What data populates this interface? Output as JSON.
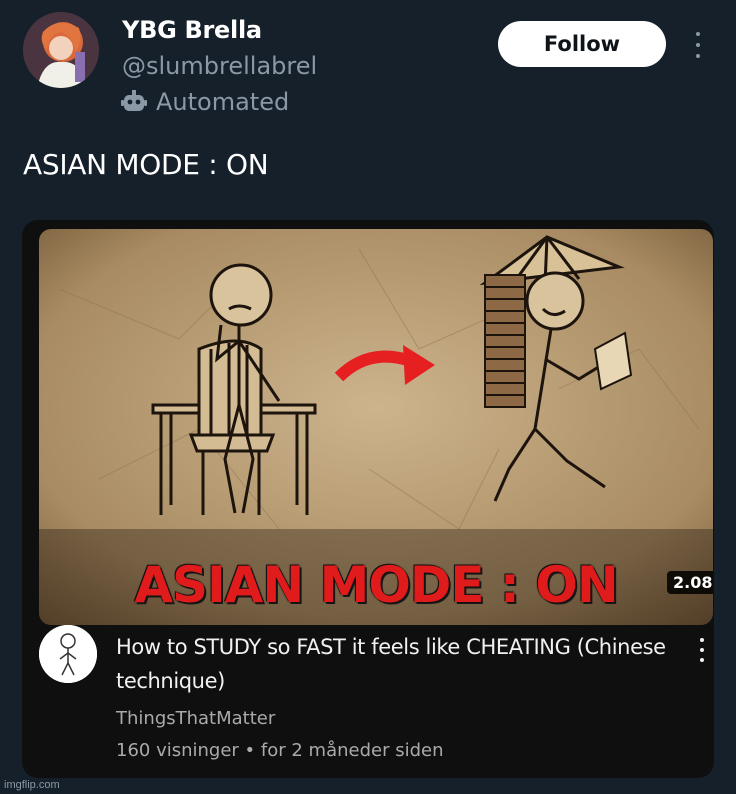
{
  "post": {
    "display_name": "YBG Brella",
    "handle": "@slumbrellabrel",
    "automated_label": "Automated",
    "follow_label": "Follow",
    "text": "ASIAN MODE : ON"
  },
  "video": {
    "thumbnail_caption": "ASIAN MODE : ON",
    "duration": "2.08",
    "title": "How to STUDY so FAST it feels like CHEATING (Chinese technique)",
    "channel": "ThingsThatMatter",
    "meta": "160 visninger • for 2 måneder siden"
  },
  "watermark": "imgflip.com",
  "icons": {
    "automated": "robot-icon",
    "more": "more-vertical-icon",
    "video_more": "more-vertical-icon"
  },
  "colors": {
    "background": "#15202b",
    "card": "#0f0f0f",
    "caption_red": "#e01b1b",
    "muted": "#8b98a5"
  }
}
